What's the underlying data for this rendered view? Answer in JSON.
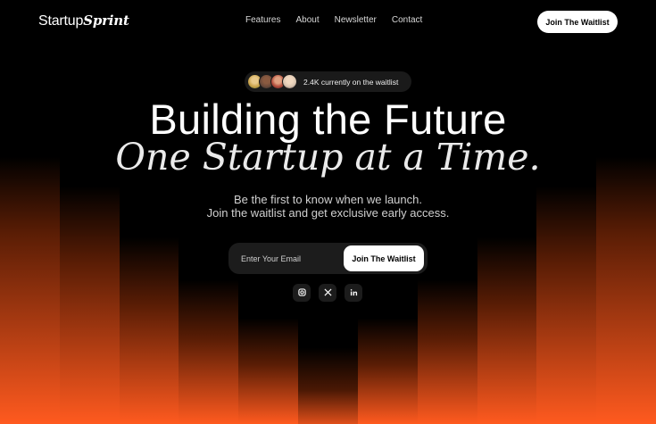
{
  "nav": {
    "logo_part1": "Startup",
    "logo_part2": "Sprint",
    "links": [
      "Features",
      "About",
      "Newsletter",
      "Contact"
    ],
    "cta": "Join The Waitlist"
  },
  "hero": {
    "pill_text": "2.4K currently on the waitlist",
    "avatar_colors": [
      "#c9a24a",
      "#6b4a3a",
      "#b14a3a",
      "#d9c4b0"
    ],
    "headline": "Building the Future",
    "headline_italic": "One Startup at a Time.",
    "subtitle_line1": "Be the first to know when we launch.",
    "subtitle_line2": "Join the waitlist and get exclusive early access."
  },
  "signup": {
    "email_placeholder": "Enter Your Email",
    "button": "Join The Waitlist"
  },
  "socials": [
    {
      "icon": "instagram-icon"
    },
    {
      "icon": "x-icon"
    },
    {
      "icon": "linkedin-icon"
    }
  ],
  "colors": {
    "accent": "#ff5a1f",
    "background": "#000000"
  }
}
